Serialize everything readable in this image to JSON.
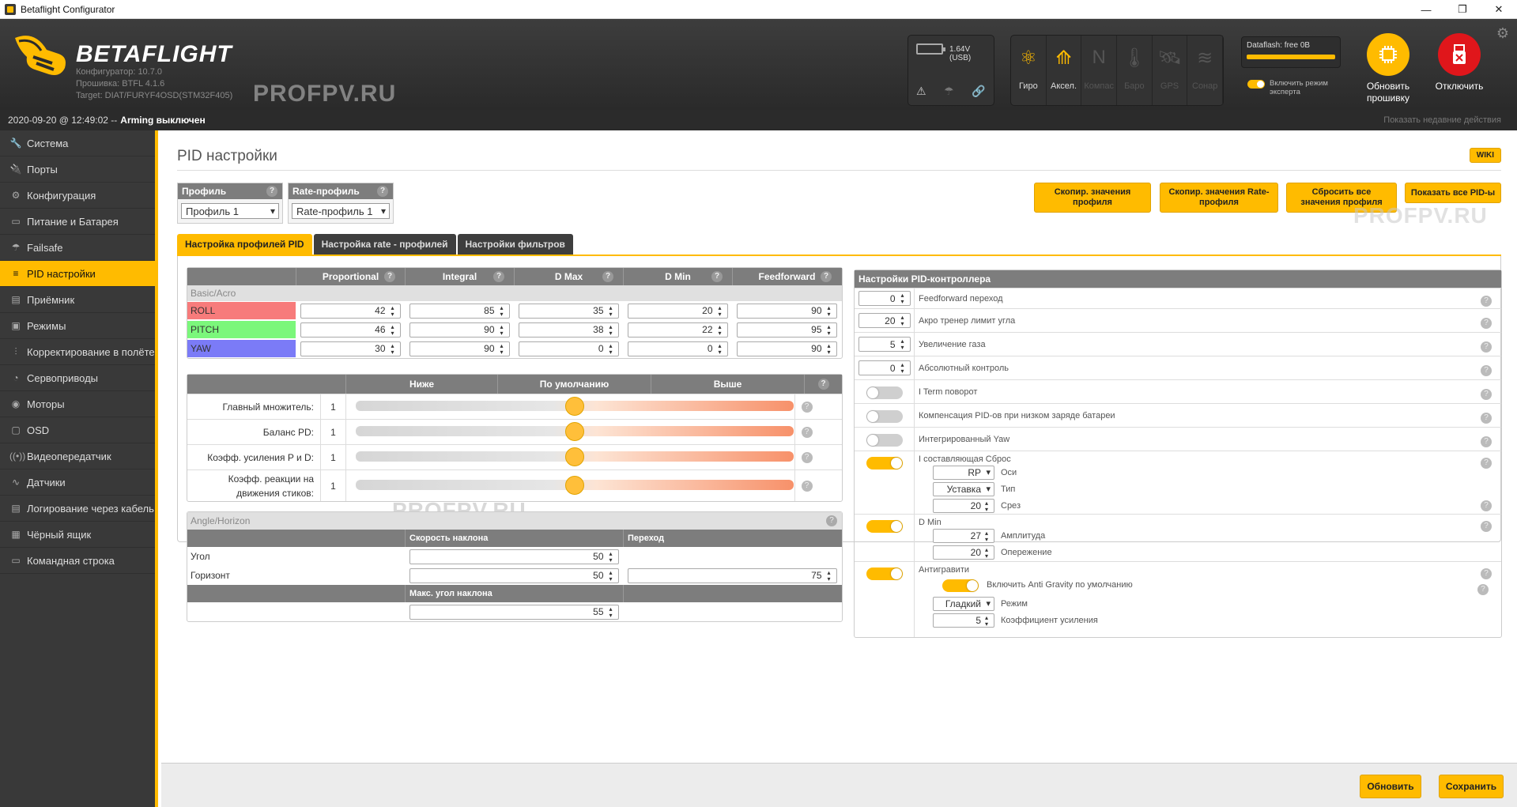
{
  "window": {
    "title": "Betaflight Configurator",
    "min": "—",
    "max": "❐",
    "close": "✕"
  },
  "header": {
    "brand": "BETAFLIGHT",
    "configurator": "Конфигуратор: 10.7.0",
    "firmware": "Прошивка: BTFL 4.1.6",
    "target": "Target: DIAT/FURYF4OSD(STM32F405)",
    "watermark": "PROFPV.RU",
    "battery": "1.64V (USB)",
    "sensors": [
      {
        "label": "Гиро",
        "icon": "gyro-icon",
        "glyph": "⚛",
        "active": true
      },
      {
        "label": "Аксел.",
        "icon": "accel-icon",
        "glyph": "⟰",
        "active": true
      },
      {
        "label": "Компас",
        "icon": "compass-icon",
        "glyph": "N",
        "active": false
      },
      {
        "label": "Баро",
        "icon": "baro-icon",
        "glyph": "🌡",
        "active": false
      },
      {
        "label": "GPS",
        "icon": "gps-icon",
        "glyph": "🛰",
        "active": false
      },
      {
        "label": "Сонар",
        "icon": "sonar-icon",
        "glyph": "≋",
        "active": false
      }
    ],
    "dataflash": "Dataflash: free 0B",
    "expert_mode": "Включить режим эксперта",
    "flash_btn": "Обновить прошивку",
    "disconnect_btn": "Отключить",
    "accent": "#ffbb00"
  },
  "status": {
    "datetime": "2020-09-20 @ 12:49:02 --",
    "arming": "Arming выключен",
    "recent": "Показать недавние действия"
  },
  "sidebar": {
    "items": [
      {
        "label": "Система",
        "icon": "wrench-icon",
        "glyph": "🔧"
      },
      {
        "label": "Порты",
        "icon": "plug-icon",
        "glyph": "🔌"
      },
      {
        "label": "Конфигурация",
        "icon": "gear-icon",
        "glyph": "⚙"
      },
      {
        "label": "Питание и Батарея",
        "icon": "battery-icon",
        "glyph": "▭"
      },
      {
        "label": "Failsafe",
        "icon": "parachute-icon",
        "glyph": "☂"
      },
      {
        "label": "PID настройки",
        "icon": "sliders-icon",
        "glyph": "≡"
      },
      {
        "label": "Приёмник",
        "icon": "receiver-icon",
        "glyph": "▤"
      },
      {
        "label": "Режимы",
        "icon": "modes-icon",
        "glyph": "▣"
      },
      {
        "label": "Корректирование в полёте",
        "icon": "adjust-icon",
        "glyph": "⫶"
      },
      {
        "label": "Сервоприводы",
        "icon": "servo-icon",
        "glyph": "◔"
      },
      {
        "label": "Моторы",
        "icon": "motor-icon",
        "glyph": "◉"
      },
      {
        "label": "OSD",
        "icon": "osd-icon",
        "glyph": "▢"
      },
      {
        "label": "Видеопередатчик",
        "icon": "vtx-icon",
        "glyph": "((•))"
      },
      {
        "label": "Датчики",
        "icon": "sensors-icon",
        "glyph": "∿"
      },
      {
        "label": "Логирование через кабель",
        "icon": "log-icon",
        "glyph": "▤"
      },
      {
        "label": "Чёрный ящик",
        "icon": "blackbox-icon",
        "glyph": "▦"
      },
      {
        "label": "Командная строка",
        "icon": "cli-icon",
        "glyph": "▭"
      }
    ]
  },
  "page": {
    "title": "PID настройки",
    "wiki": "WIKI"
  },
  "profile": {
    "label": "Профиль",
    "value": "Профиль 1"
  },
  "rate_profile": {
    "label": "Rate-профиль",
    "value": "Rate-профиль 1"
  },
  "actions": {
    "copy_profile": "Скопир. значения профиля",
    "copy_rate": "Скопир. значения Rate-профиля",
    "reset_all": "Сбросить все значения профиля",
    "show_all": "Показать все PID-ы"
  },
  "tabs": [
    "Настройка профилей PID",
    "Настройка rate - профилей",
    "Настройки фильтров"
  ],
  "pid": {
    "headers": [
      "Proportional",
      "Integral",
      "D Max",
      "D Min",
      "Feedforward"
    ],
    "section": "Basic/Acro",
    "rows": [
      {
        "axis": "ROLL",
        "color": "#f77b7b",
        "values": [
          42,
          85,
          35,
          20,
          90
        ]
      },
      {
        "axis": "PITCH",
        "color": "#7bf77b",
        "values": [
          46,
          90,
          38,
          22,
          95
        ]
      },
      {
        "axis": "YAW",
        "color": "#7b7bf7",
        "values": [
          30,
          90,
          0,
          0,
          90
        ]
      }
    ]
  },
  "sliders": {
    "headers": [
      "Ниже",
      "По умолчанию",
      "Выше"
    ],
    "rows": [
      {
        "label": "Главный множитель:",
        "value": "1",
        "level": 0.5
      },
      {
        "label": "Баланс PD:",
        "value": "1",
        "level": 0.5
      },
      {
        "label": "Коэфф. усиления P и D:",
        "value": "1",
        "level": 0.5
      },
      {
        "label": "Коэфф. реакции на движения стиков:",
        "value": "1",
        "level": 0.5
      }
    ]
  },
  "angle": {
    "title": "Angle/Horizon",
    "col_rate": "Скорость наклона",
    "col_transition": "Переход",
    "angle_label": "Угол",
    "angle_rate": 50,
    "horizon_label": "Горизонт",
    "horizon_rate": 50,
    "horizon_transition": 75,
    "max_angle_label": "Макс. угол наклона",
    "max_angle": 55
  },
  "controller": {
    "title": "Настройки PID-контроллера",
    "ff_transition": {
      "value": 0,
      "label": "Feedforward переход"
    },
    "acro_trainer": {
      "value": 20,
      "label": "Акро тренер лимит угла"
    },
    "throttle_boost": {
      "value": 5,
      "label": "Увеличение газа"
    },
    "absolute_control": {
      "value": 0,
      "label": "Абсолютный контроль"
    },
    "iterm_rotation": "I Term поворот",
    "vbat_comp": "Компенсация PID-ов при низком заряде батареи",
    "integrated_yaw": "Интегрированный Yaw",
    "iterm_relax": {
      "label": "I составляющая Сброс",
      "axes": "RP",
      "axes_label": "Оси",
      "type": "Уставка",
      "type_label": "Тип",
      "cutoff": 20,
      "cutoff_label": "Срез"
    },
    "dmin": {
      "label": "D Min",
      "gain": 27,
      "gain_label": "Амплитуда",
      "advance": 20,
      "advance_label": "Опережение"
    },
    "antigravity": {
      "label": "Антигравити",
      "enable_label": "Включить Anti Gravity по умолчанию",
      "mode": "Гладкий",
      "mode_label": "Режим",
      "gain": 5,
      "gain_label": "Коэффициент усиления"
    }
  },
  "footer": {
    "refresh": "Обновить",
    "save": "Сохранить"
  }
}
